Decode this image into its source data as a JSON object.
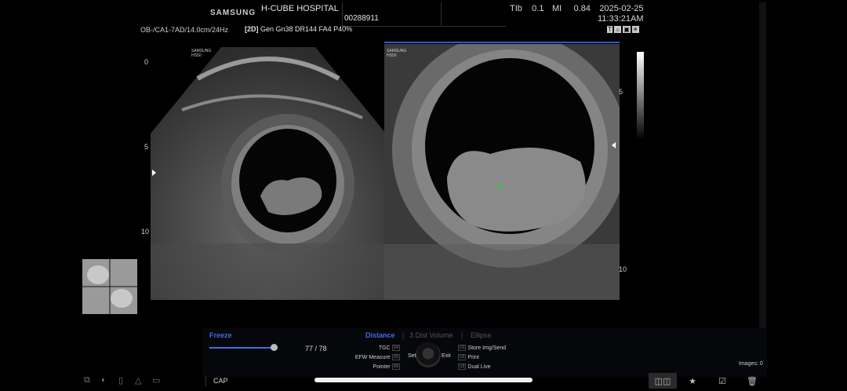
{
  "header": {
    "brand": "SAMSUNG",
    "hospital": "H-CUBE HOSPITAL",
    "patient_id": "00288911",
    "tib_label": "TIb",
    "tib_value": "0.1",
    "mi_label": "MI",
    "mi_value": "0.84",
    "date": "2025-02-25",
    "time": "11:33:21AM"
  },
  "probe_info": "OB-/CA1-7AD/14.0cm/24Hz",
  "mode_info": {
    "mode": "[2D]",
    "params": "Gen Gn38 DR144 FA4 P40%"
  },
  "status_icons": [
    "T",
    "☼",
    "▣",
    "✳"
  ],
  "left_image": {
    "watermark": "SAMSUNG HS50",
    "depth_labels": [
      "0",
      "5",
      "10"
    ]
  },
  "right_image": {
    "watermark": "SAMSUNG HS50",
    "depth_labels": [
      "5",
      "10"
    ]
  },
  "controls": {
    "freeze_label": "Freeze",
    "frames": "77 / 78",
    "freeze_progress": 0.987,
    "tabs": [
      "Distance",
      "3 Dist Volume",
      "Ellipse"
    ],
    "left_menu": [
      {
        "label": "TGC",
        "key": "U4"
      },
      {
        "label": "EFW Measure",
        "key": "U5"
      },
      {
        "label": "Pointer",
        "key": "U6"
      }
    ],
    "right_menu": [
      {
        "label": "Store Img/Send",
        "key": "U1"
      },
      {
        "label": "Print",
        "key": "U2"
      },
      {
        "label": "Dual Live",
        "key": "U3"
      }
    ],
    "set_label": "Set",
    "exit_label": "Exit",
    "images_count": "Images: 0"
  },
  "bottom_bar": {
    "cap_label": "CAP",
    "left_icons": [
      "copy-icon",
      "moon-icon",
      "battery-icon",
      "warning-icon",
      "monitor-icon"
    ],
    "right_buttons": [
      "dual-view-icon",
      "star-icon",
      "check-icon",
      "trash-icon"
    ]
  },
  "colors": {
    "accent": "#3f6ee6",
    "background": "#000000"
  }
}
